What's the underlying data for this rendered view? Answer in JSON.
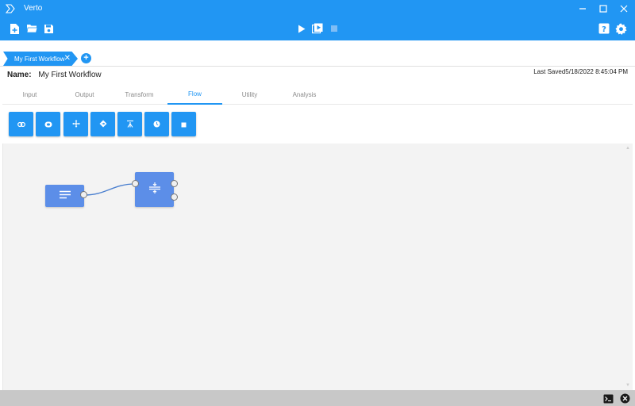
{
  "window": {
    "title": "Verto",
    "icon": "chevron-logo-icon",
    "controls": [
      "minimize-icon",
      "maximize-icon",
      "close-icon"
    ]
  },
  "toolbar": {
    "left": [
      "new-file-icon",
      "open-folder-icon",
      "save-icon"
    ],
    "center": [
      "run-icon",
      "run-step-icon",
      "stop-icon"
    ],
    "right": [
      "help-icon",
      "settings-icon"
    ]
  },
  "document_tab": {
    "label": "My First Workflow",
    "close_label": "✕",
    "add_label": "+"
  },
  "workflow": {
    "name_label": "Name:",
    "name_value": "My First Workflow",
    "last_saved_label": "Last Saved",
    "last_saved_value": "5/18/2022 8:45:04 PM"
  },
  "category_tabs": [
    {
      "label": "Input",
      "active": false
    },
    {
      "label": "Output",
      "active": false
    },
    {
      "label": "Transform",
      "active": false
    },
    {
      "label": "Flow",
      "active": true
    },
    {
      "label": "Utility",
      "active": false
    },
    {
      "label": "Analysis",
      "active": false
    }
  ],
  "flow_tools": [
    "link-icon",
    "loop-icon",
    "move-icon",
    "decision-icon",
    "branch-icon",
    "timer-icon",
    "stop-icon"
  ],
  "canvas": {
    "nodes": [
      {
        "icon": "text-lines-icon"
      },
      {
        "icon": "split-icon"
      }
    ]
  },
  "statusbar": [
    "terminal-icon",
    "close-circle-icon"
  ],
  "colors": {
    "accent": "#2196f3",
    "node": "#5c8ee8",
    "canvas": "#f3f3f3",
    "statusbar": "#c8c8c8"
  }
}
